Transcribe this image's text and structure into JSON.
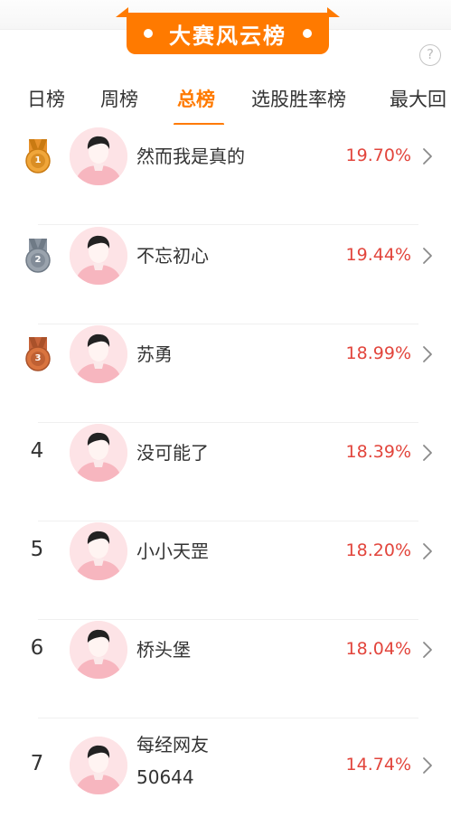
{
  "header": {
    "banner_title": "大赛风云榜",
    "help_glyph": "?"
  },
  "tabs": [
    {
      "label": "日榜",
      "active": false
    },
    {
      "label": "周榜",
      "active": false
    },
    {
      "label": "总榜",
      "active": true
    },
    {
      "label": "选股胜率榜",
      "active": false
    },
    {
      "label": "最大回",
      "active": false
    }
  ],
  "colors": {
    "accent": "#ff7a00",
    "rate_red": "#e2453c",
    "gold": "#f0a63a",
    "silver": "#9aa3ad",
    "bronze": "#d9743f"
  },
  "ranking": [
    {
      "rank": "1",
      "medal": "gold",
      "name": "然而我是真的",
      "rate": "19.70%"
    },
    {
      "rank": "2",
      "medal": "silver",
      "name": "不忘初心",
      "rate": "19.44%"
    },
    {
      "rank": "3",
      "medal": "bronze",
      "name": "苏勇",
      "rate": "18.99%"
    },
    {
      "rank": "4",
      "medal": null,
      "name": "没可能了",
      "rate": "18.39%"
    },
    {
      "rank": "5",
      "medal": null,
      "name": "小小天罡",
      "rate": "18.20%"
    },
    {
      "rank": "6",
      "medal": null,
      "name": "桥头堡",
      "rate": "18.04%"
    },
    {
      "rank": "7",
      "medal": null,
      "name": "每经网友",
      "name2": "50644",
      "rate": "14.74%"
    }
  ]
}
